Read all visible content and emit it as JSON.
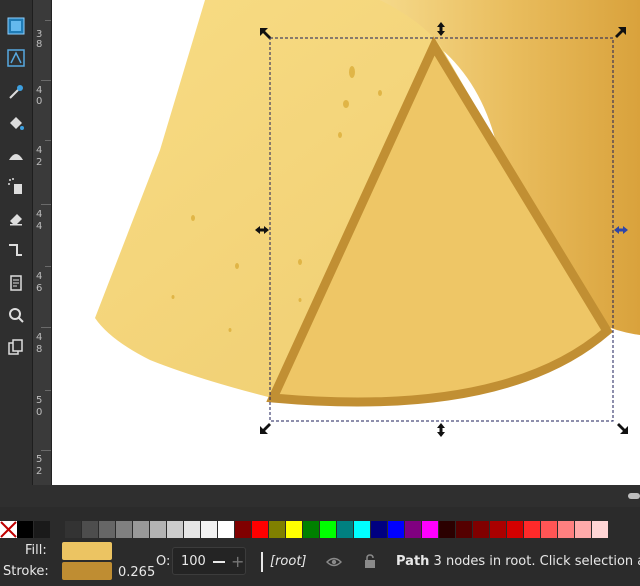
{
  "toolbox": {
    "tools": [
      {
        "name": "selector-tool",
        "icon": "selector-arrow-icon",
        "active": true
      },
      {
        "name": "node-tool",
        "icon": "node-edit-icon"
      },
      {
        "name": "dropper-tool",
        "icon": "dropper-icon"
      },
      {
        "name": "paint-bucket-tool",
        "icon": "paint-bucket-icon"
      },
      {
        "name": "tweak-tool",
        "icon": "tweak-icon"
      },
      {
        "name": "spray-tool",
        "icon": "spray-icon"
      },
      {
        "name": "eraser-tool",
        "icon": "eraser-icon"
      },
      {
        "name": "connector-tool",
        "icon": "connector-icon"
      },
      {
        "name": "pages-tool",
        "icon": "pages-icon"
      },
      {
        "name": "zoom-tool",
        "icon": "zoom-icon"
      },
      {
        "name": "measure-tool",
        "icon": "clone-icon"
      }
    ]
  },
  "ruler": {
    "labels": [
      "3",
      "8",
      "4",
      "0",
      "4",
      "2",
      "4",
      "4",
      "4",
      "6",
      "4",
      "8",
      "5",
      "0",
      "5",
      "2"
    ]
  },
  "palette": {
    "colors": [
      "#000000",
      "#1a1a1a",
      "#333333",
      "#4d4d4d",
      "#666666",
      "#808080",
      "#999999",
      "#b3b3b3",
      "#cccccc",
      "#e6e6e6",
      "#f2f2f2",
      "#ffffff",
      "#800000",
      "#ff0000",
      "#808000",
      "#ffff00",
      "#008000",
      "#00ff00",
      "#008080",
      "#00ffff",
      "#000080",
      "#0000ff",
      "#800080",
      "#ff00ff",
      "#2b0000",
      "#550000",
      "#800000",
      "#aa0000",
      "#d40000",
      "#ff2a2a",
      "#ff5555",
      "#ff8080",
      "#ffaaaa",
      "#ffd5d5"
    ]
  },
  "status": {
    "fill_label": "Fill:",
    "stroke_label": "Stroke:",
    "fill_color": "#ecc462",
    "stroke_color": "#bf8d32",
    "stroke_width": "0.265",
    "opacity_label": "O:",
    "opacity_value": "100",
    "layer_name": "[root]",
    "message_bold": "Path",
    "message_text": " 3 nodes in root. Click selection a"
  },
  "canvas": {
    "shape_fill": "#eec666",
    "shape_stroke": "#c18f33",
    "selection_color": "#1b1d5a"
  }
}
